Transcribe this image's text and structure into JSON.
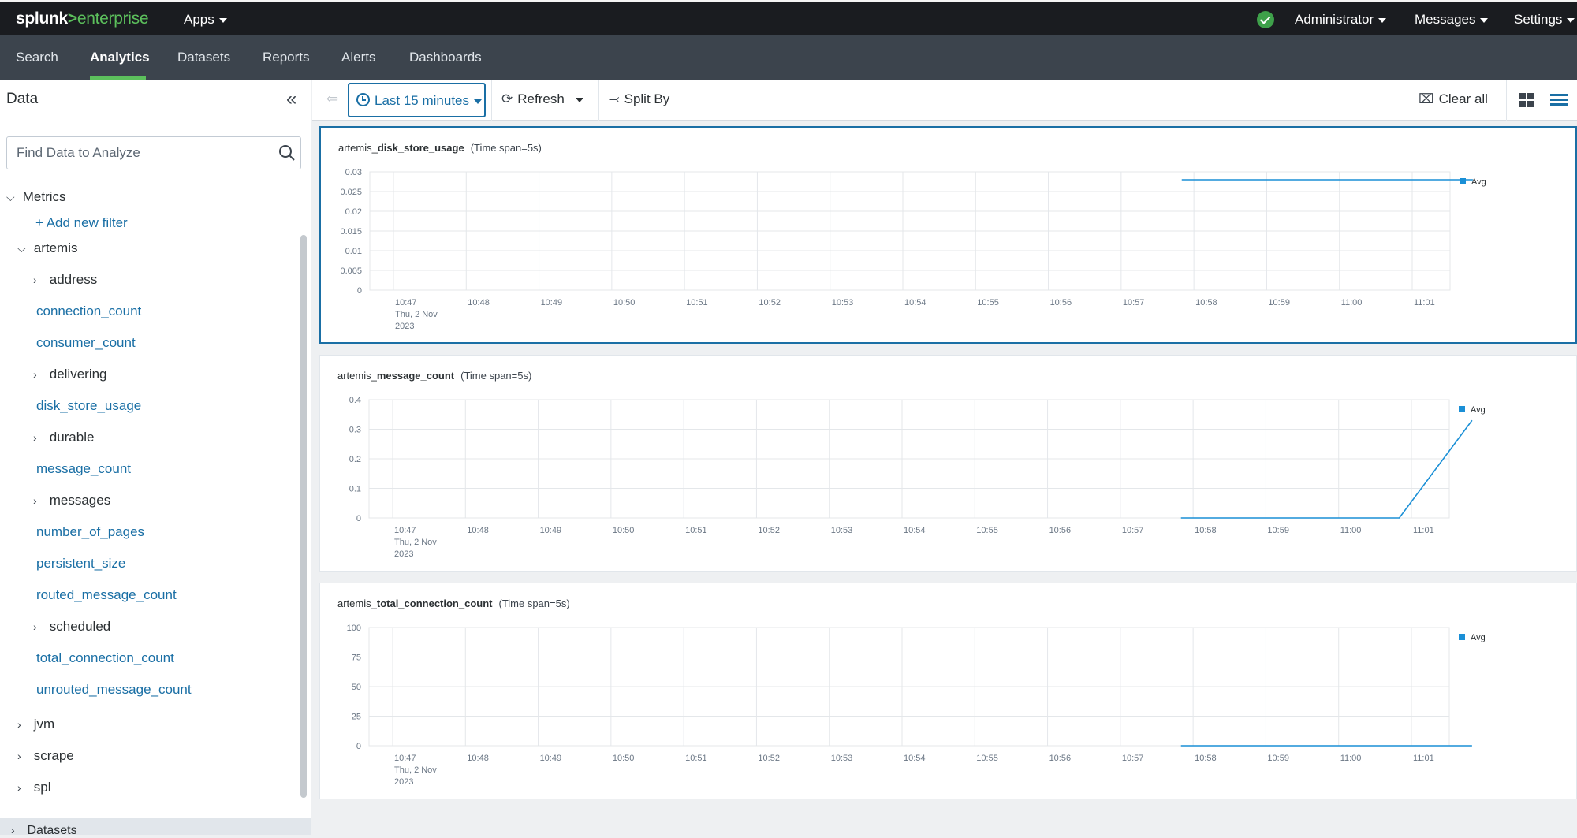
{
  "topbar": {
    "brand_main": "splunk",
    "brand_gt": ">",
    "brand_sub": "enterprise",
    "apps": "Apps",
    "user": "Administrator",
    "messages": "Messages",
    "settings": "Settings"
  },
  "nav": {
    "tabs": [
      "Search",
      "Analytics",
      "Datasets",
      "Reports",
      "Alerts",
      "Dashboards"
    ],
    "active": "Analytics"
  },
  "sidebar": {
    "title": "Data",
    "search_placeholder": "Find Data to Analyze",
    "metrics_label": "Metrics",
    "add_filter": "+ Add new filter",
    "artemis": "artemis",
    "items": [
      {
        "label": "address",
        "type": "group"
      },
      {
        "label": "connection_count",
        "type": "metric"
      },
      {
        "label": "consumer_count",
        "type": "metric"
      },
      {
        "label": "delivering",
        "type": "group"
      },
      {
        "label": "disk_store_usage",
        "type": "metric"
      },
      {
        "label": "durable",
        "type": "group"
      },
      {
        "label": "message_count",
        "type": "metric"
      },
      {
        "label": "messages",
        "type": "group"
      },
      {
        "label": "number_of_pages",
        "type": "metric"
      },
      {
        "label": "persistent_size",
        "type": "metric"
      },
      {
        "label": "routed_message_count",
        "type": "metric"
      },
      {
        "label": "scheduled",
        "type": "group"
      },
      {
        "label": "total_connection_count",
        "type": "metric"
      },
      {
        "label": "unrouted_message_count",
        "type": "metric"
      }
    ],
    "top_groups": [
      "jvm",
      "scrape",
      "spl"
    ],
    "footer": "Datasets"
  },
  "toolbar": {
    "time_range": "Last 15 minutes",
    "refresh": "Refresh",
    "split_by": "Split By",
    "clear_all": "Clear all"
  },
  "panels": [
    {
      "prefix": "artemis_",
      "metric": "disk_store_usage",
      "span": "(Time span=5s)"
    },
    {
      "prefix": "artemis_",
      "metric": "message_count",
      "span": "(Time span=5s)"
    },
    {
      "prefix": "artemis_",
      "metric": "total_connection_count",
      "span": "(Time span=5s)"
    }
  ],
  "colors": {
    "series": "#1a8fd6",
    "accent": "#1a6fa5",
    "ok": "#3ea04a"
  },
  "chart_data": [
    {
      "type": "line",
      "title": "artemis_disk_store_usage (Time span=5s)",
      "x": [
        "10:47",
        "10:48",
        "10:49",
        "10:50",
        "10:51",
        "10:52",
        "10:53",
        "10:54",
        "10:55",
        "10:56",
        "10:57",
        "10:58",
        "10:59",
        "11:00",
        "11:01"
      ],
      "x_first_sub": [
        "Thu, 2 Nov",
        "2023"
      ],
      "yticks": [
        "0",
        "0.005",
        "0.01",
        "0.015",
        "0.02",
        "0.025",
        "0.03"
      ],
      "ylim": [
        0,
        0.03
      ],
      "legend": "Avg",
      "series": [
        {
          "name": "Avg",
          "points": [
            [
              10.833,
              0.028
            ],
            [
              14.833,
              0.028
            ]
          ]
        }
      ]
    },
    {
      "type": "line",
      "title": "artemis_message_count (Time span=5s)",
      "x": [
        "10:47",
        "10:48",
        "10:49",
        "10:50",
        "10:51",
        "10:52",
        "10:53",
        "10:54",
        "10:55",
        "10:56",
        "10:57",
        "10:58",
        "10:59",
        "11:00",
        "11:01"
      ],
      "x_first_sub": [
        "Thu, 2 Nov",
        "2023"
      ],
      "yticks": [
        "0",
        "0.1",
        "0.2",
        "0.3",
        "0.4"
      ],
      "ylim": [
        0,
        0.4
      ],
      "legend": "Avg",
      "series": [
        {
          "name": "Avg",
          "points": [
            [
              10.833,
              0
            ],
            [
              13.833,
              0
            ],
            [
              14.833,
              0.33
            ]
          ]
        }
      ]
    },
    {
      "type": "line",
      "title": "artemis_total_connection_count (Time span=5s)",
      "x": [
        "10:47",
        "10:48",
        "10:49",
        "10:50",
        "10:51",
        "10:52",
        "10:53",
        "10:54",
        "10:55",
        "10:56",
        "10:57",
        "10:58",
        "10:59",
        "11:00",
        "11:01"
      ],
      "x_first_sub": [
        "Thu, 2 Nov",
        "2023"
      ],
      "yticks": [
        "0",
        "25",
        "50",
        "75",
        "100"
      ],
      "ylim": [
        0,
        100
      ],
      "legend": "Avg",
      "series": [
        {
          "name": "Avg",
          "points": [
            [
              10.833,
              0
            ],
            [
              14.833,
              0
            ]
          ]
        }
      ]
    }
  ]
}
